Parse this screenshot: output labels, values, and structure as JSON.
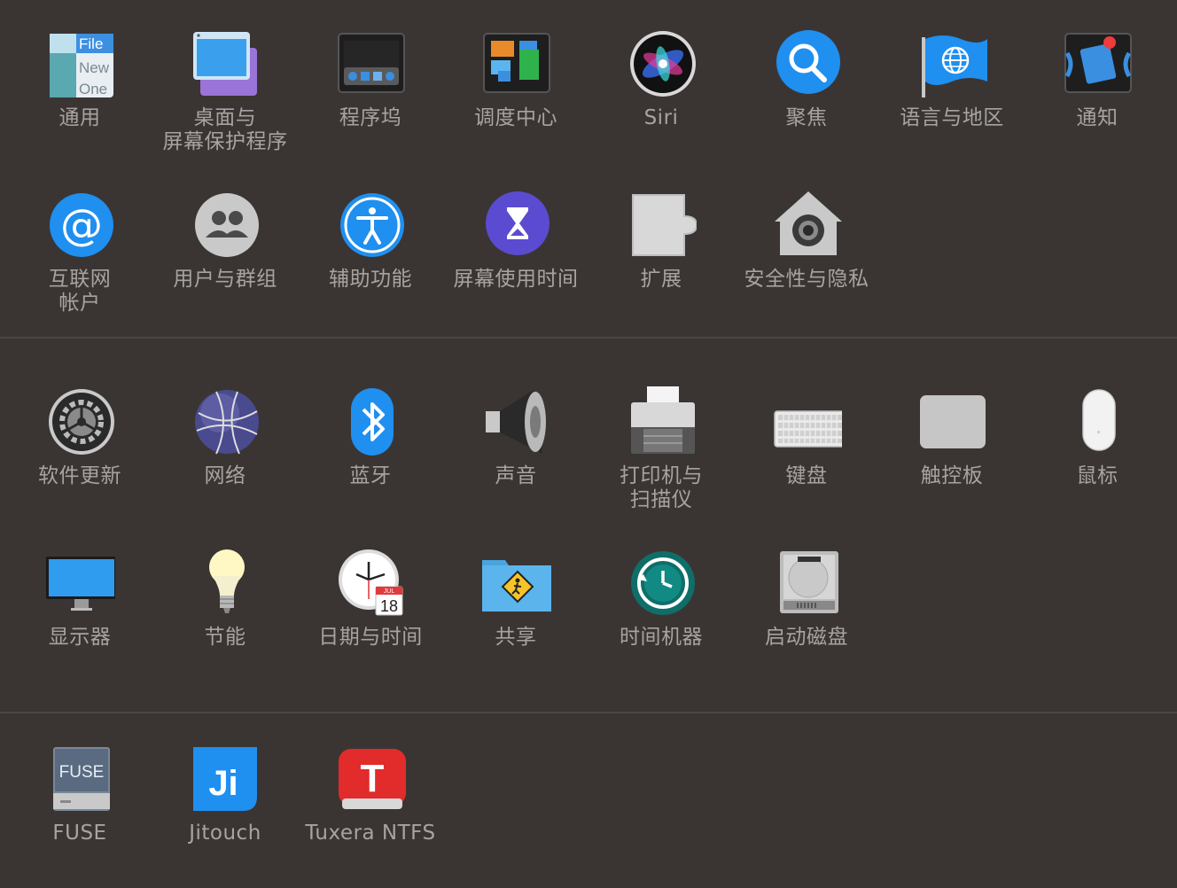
{
  "sections": [
    {
      "panes": [
        {
          "label": "通用",
          "icon": "general-icon"
        },
        {
          "label": "桌面与\n屏幕保护程序",
          "icon": "desktop-screensaver-icon"
        },
        {
          "label": "程序坞",
          "icon": "dock-icon"
        },
        {
          "label": "调度中心",
          "icon": "mission-control-icon"
        },
        {
          "label": "Siri",
          "icon": "siri-icon"
        },
        {
          "label": "聚焦",
          "icon": "spotlight-icon"
        },
        {
          "label": "语言与地区",
          "icon": "language-region-icon"
        },
        {
          "label": "通知",
          "icon": "notifications-icon"
        },
        {
          "label": "互联网\n帐户",
          "icon": "internet-accounts-icon"
        },
        {
          "label": "用户与群组",
          "icon": "users-groups-icon"
        },
        {
          "label": "辅助功能",
          "icon": "accessibility-icon"
        },
        {
          "label": "屏幕使用时间",
          "icon": "screen-time-icon"
        },
        {
          "label": "扩展",
          "icon": "extensions-icon"
        },
        {
          "label": "安全性与隐私",
          "icon": "security-privacy-icon"
        }
      ]
    },
    {
      "panes": [
        {
          "label": "软件更新",
          "icon": "software-update-icon"
        },
        {
          "label": "网络",
          "icon": "network-icon"
        },
        {
          "label": "蓝牙",
          "icon": "bluetooth-icon"
        },
        {
          "label": "声音",
          "icon": "sound-icon"
        },
        {
          "label": "打印机与\n扫描仪",
          "icon": "printers-scanners-icon"
        },
        {
          "label": "键盘",
          "icon": "keyboard-icon"
        },
        {
          "label": "触控板",
          "icon": "trackpad-icon"
        },
        {
          "label": "鼠标",
          "icon": "mouse-icon"
        },
        {
          "label": "显示器",
          "icon": "displays-icon"
        },
        {
          "label": "节能",
          "icon": "energy-saver-icon"
        },
        {
          "label": "日期与时间",
          "icon": "date-time-icon"
        },
        {
          "label": "共享",
          "icon": "sharing-icon"
        },
        {
          "label": "时间机器",
          "icon": "time-machine-icon"
        },
        {
          "label": "启动磁盘",
          "icon": "startup-disk-icon"
        }
      ]
    },
    {
      "panes": [
        {
          "label": "FUSE",
          "icon": "fuse-icon"
        },
        {
          "label": "Jitouch",
          "icon": "jitouch-icon"
        },
        {
          "label": "Tuxera NTFS",
          "icon": "tuxera-ntfs-icon"
        }
      ]
    }
  ],
  "icon_text": {
    "general": [
      "File",
      "New",
      "One"
    ],
    "calendar_month": "JUL",
    "calendar_day": "18",
    "fuse": "FUSE",
    "jitouch": "Ji",
    "tuxera": "T"
  },
  "colors": {
    "background": "#3a3533",
    "label": "#a7a3a0",
    "divider": "#4b4644"
  }
}
